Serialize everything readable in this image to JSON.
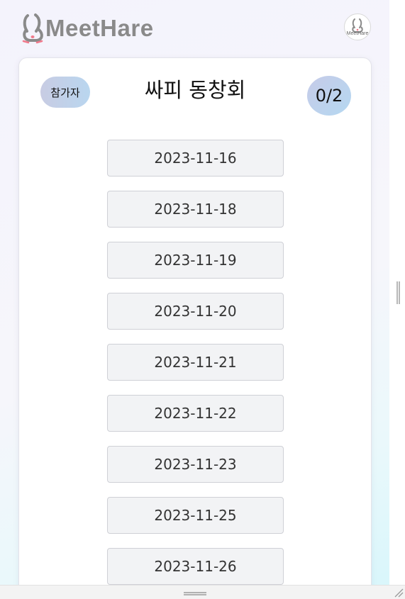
{
  "header": {
    "logo_text": "MeetHare",
    "avatar_text": "MeetHare"
  },
  "card": {
    "participants_label": "참가자",
    "title": "싸피 동창회",
    "count": "0/2",
    "dates": [
      "2023-11-16",
      "2023-11-18",
      "2023-11-19",
      "2023-11-20",
      "2023-11-21",
      "2023-11-22",
      "2023-11-23",
      "2023-11-25",
      "2023-11-26"
    ]
  },
  "colors": {
    "logo_gray": "#8a8a8a",
    "logo_pink": "#f07a8c",
    "badge_from": "#c6cbe8",
    "badge_to": "#b5d8f1",
    "date_bg": "#f2f3f5"
  },
  "icons": {
    "logo": "rabbit-logo-icon",
    "avatar": "rabbit-avatar-icon"
  }
}
